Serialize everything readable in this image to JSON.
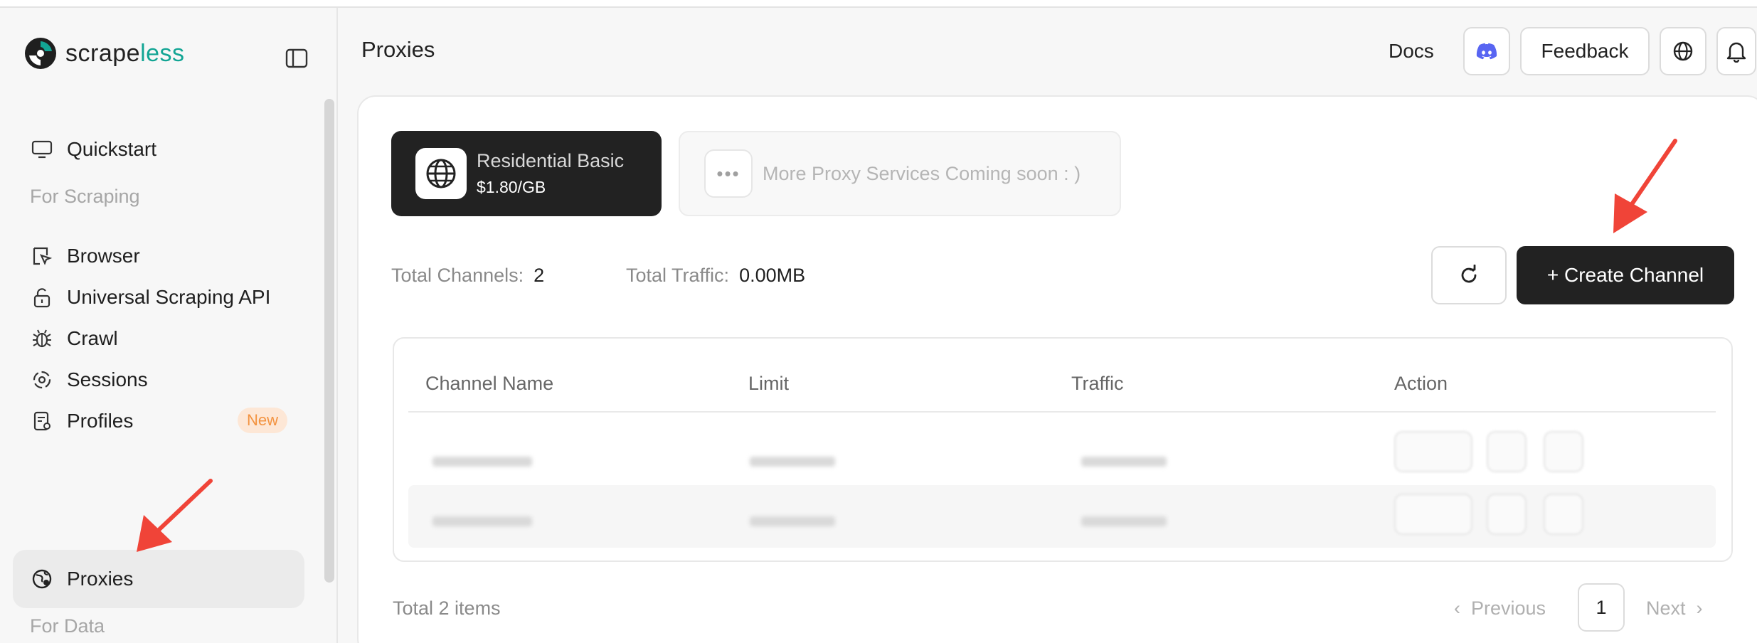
{
  "app": {
    "brand_prefix": "scrape",
    "brand_suffix": "less",
    "accent_color": "#12a594"
  },
  "sidebar": {
    "items": [
      {
        "label": "Quickstart",
        "icon": "monitor-icon"
      },
      {
        "label": "Browser",
        "icon": "cursor-icon"
      },
      {
        "label": "Universal Scraping API",
        "icon": "unlock-icon"
      },
      {
        "label": "Crawl",
        "icon": "bug-icon"
      },
      {
        "label": "Sessions",
        "icon": "sessions-icon"
      },
      {
        "label": "Profiles",
        "icon": "profile-doc-icon",
        "badge": "New"
      },
      {
        "label": "Proxies",
        "icon": "globe-pin-icon",
        "active": true
      }
    ],
    "sections": [
      "For Scraping",
      "For Data"
    ]
  },
  "header": {
    "title": "Proxies",
    "docs": "Docs",
    "feedback": "Feedback",
    "discord_icon": "discord-icon",
    "language_icon": "globe-icon",
    "notification_icon": "bell-icon"
  },
  "services": {
    "residential": {
      "name": "Residential Basic",
      "price": "$1.80/GB"
    },
    "more": {
      "text": "More Proxy Services Coming soon : )"
    }
  },
  "stats": {
    "channels_label": "Total Channels:",
    "channels_value": "2",
    "traffic_label": "Total Traffic:",
    "traffic_value": "0.00MB"
  },
  "actions": {
    "create": "+ Create Channel"
  },
  "table": {
    "columns": [
      "Channel Name",
      "Limit",
      "Traffic",
      "Action"
    ]
  },
  "pagination": {
    "total": "Total 2 items",
    "prev": "Previous",
    "page": "1",
    "next": "Next"
  },
  "colors": {
    "dark": "#222222",
    "badge_bg": "#fde7d6",
    "badge_text": "#f39340",
    "annotation_arrow": "#f04438"
  }
}
